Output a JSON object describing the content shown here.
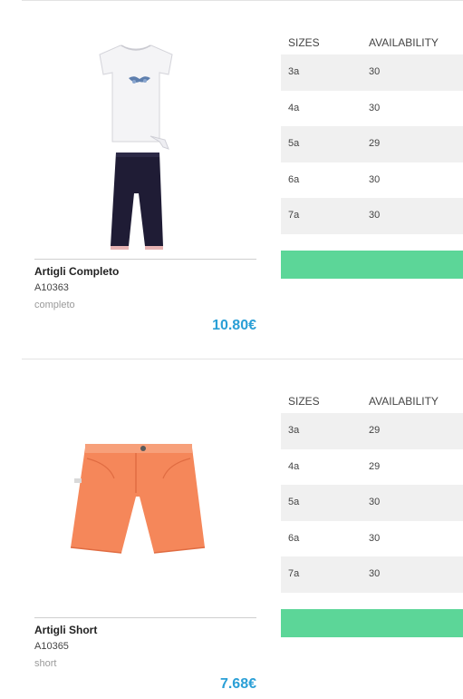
{
  "products": [
    {
      "name": "Artigli Completo",
      "code": "A10363",
      "category": "completo",
      "price": "10.80€",
      "sizes_header": "SIZES",
      "availability_header": "AVAILABILITY",
      "rows": [
        {
          "size": "3a",
          "qty": "30"
        },
        {
          "size": "4a",
          "qty": "30"
        },
        {
          "size": "5a",
          "qty": "29"
        },
        {
          "size": "6a",
          "qty": "30"
        },
        {
          "size": "7a",
          "qty": "30"
        }
      ]
    },
    {
      "name": "Artigli Short",
      "code": "A10365",
      "category": "short",
      "price": "7.68€",
      "sizes_header": "SIZES",
      "availability_header": "AVAILABILITY",
      "rows": [
        {
          "size": "3a",
          "qty": "29"
        },
        {
          "size": "4a",
          "qty": "29"
        },
        {
          "size": "5a",
          "qty": "30"
        },
        {
          "size": "6a",
          "qty": "30"
        },
        {
          "size": "7a",
          "qty": "30"
        }
      ]
    }
  ],
  "colors": {
    "price": "#2a9fd6",
    "action": "#5cd698",
    "row_shade": "#f0f0f0",
    "shorts": "#f5875a",
    "leggings": "#1f1c35"
  }
}
